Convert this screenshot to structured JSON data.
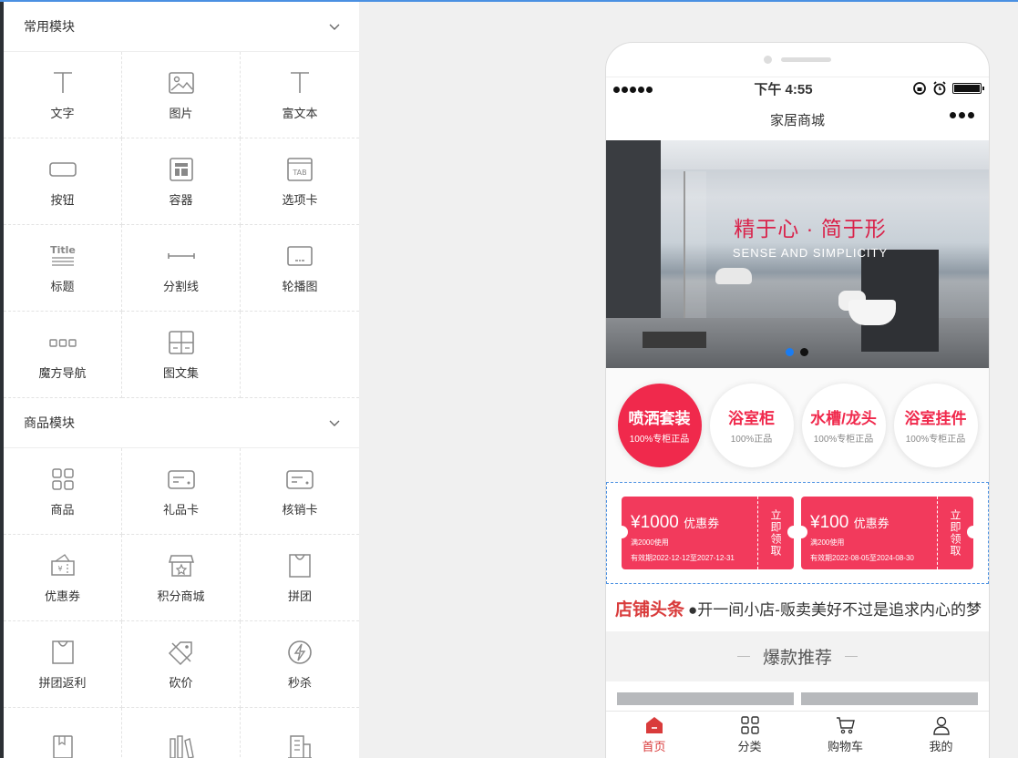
{
  "sections": [
    {
      "title": "常用模块",
      "items": [
        {
          "label": "文字",
          "icon": "text-icon"
        },
        {
          "label": "图片",
          "icon": "image-icon"
        },
        {
          "label": "富文本",
          "icon": "richtext-icon"
        },
        {
          "label": "按钮",
          "icon": "button-icon"
        },
        {
          "label": "容器",
          "icon": "container-icon"
        },
        {
          "label": "选项卡",
          "icon": "tab-icon"
        },
        {
          "label": "标题",
          "icon": "title-icon"
        },
        {
          "label": "分割线",
          "icon": "divider-icon"
        },
        {
          "label": "轮播图",
          "icon": "carousel-icon"
        },
        {
          "label": "魔方导航",
          "icon": "cube-nav-icon"
        },
        {
          "label": "图文集",
          "icon": "gallery-icon"
        }
      ]
    },
    {
      "title": "商品模块",
      "items": [
        {
          "label": "商品",
          "icon": "goods-icon"
        },
        {
          "label": "礼品卡",
          "icon": "gift-card-icon"
        },
        {
          "label": "核销卡",
          "icon": "verify-card-icon"
        },
        {
          "label": "优惠券",
          "icon": "coupon-icon"
        },
        {
          "label": "积分商城",
          "icon": "points-mall-icon"
        },
        {
          "label": "拼团",
          "icon": "group-buy-icon"
        },
        {
          "label": "拼团返利",
          "icon": "group-rebate-icon"
        },
        {
          "label": "砍价",
          "icon": "bargain-icon"
        },
        {
          "label": "秒杀",
          "icon": "flash-sale-icon"
        }
      ]
    }
  ],
  "phone": {
    "status": {
      "time": "下午 4:55"
    },
    "nav_title": "家居商城",
    "banner": {
      "title_cn": "精于心 · 简于形",
      "title_en": "SENSE AND SIMPLICITY",
      "slide_count": 2,
      "active_slide": 1
    },
    "categories": [
      {
        "title": "喷洒套装",
        "sub": "100%专柜正品"
      },
      {
        "title": "浴室柜",
        "sub": "100%正品"
      },
      {
        "title": "水槽/龙头",
        "sub": "100%专柜正品"
      },
      {
        "title": "浴室挂件",
        "sub": "100%专柜正品"
      }
    ],
    "coupons": [
      {
        "amount": "¥1000",
        "unit": "优惠券",
        "condition": "满2000使用",
        "validity": "有效期2022-12-12至2027-12-31",
        "action": "立即领取"
      },
      {
        "amount": "¥100",
        "unit": "优惠券",
        "condition": "满200使用",
        "validity": "有效期2022-08-05至2024-08-30",
        "action": "立即领取"
      }
    ],
    "headline": {
      "title": "店铺头条",
      "text": "●开一间小店-贩卖美好不过是追求内心的梦"
    },
    "recommend_title": "爆款推荐",
    "tabbar": [
      {
        "label": "首页",
        "icon": "home-icon",
        "active": true
      },
      {
        "label": "分类",
        "icon": "category-icon",
        "active": false
      },
      {
        "label": "购物车",
        "icon": "cart-icon",
        "active": false
      },
      {
        "label": "我的",
        "icon": "user-icon",
        "active": false
      }
    ]
  },
  "colors": {
    "accent": "#f0294c",
    "headline": "#d93b3b",
    "selection": "#4a90e2"
  }
}
